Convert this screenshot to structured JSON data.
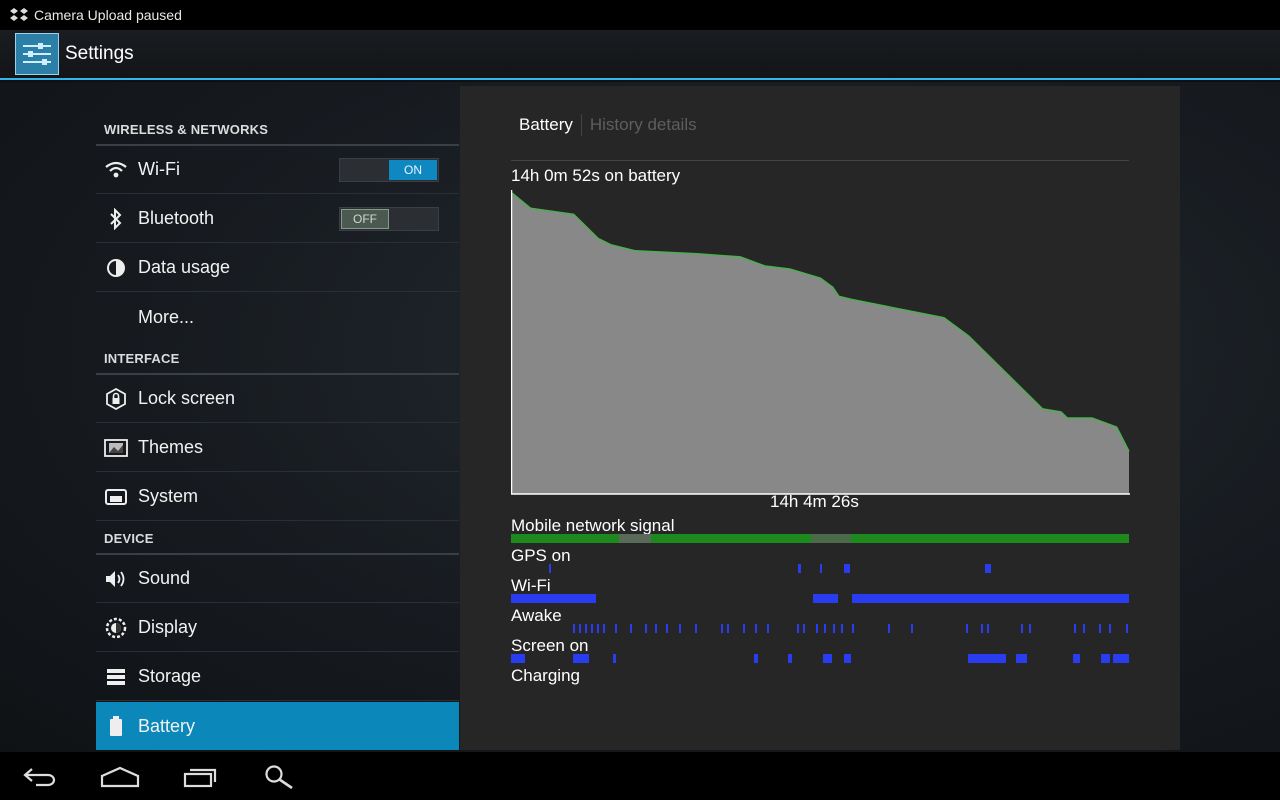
{
  "status_bar": {
    "notification_text": "Camera Upload paused",
    "icon": "dropbox-icon"
  },
  "action_bar": {
    "title": "Settings",
    "icon": "settings-sliders-icon"
  },
  "sidebar": {
    "sections": [
      {
        "header": "WIRELESS & NETWORKS",
        "items": [
          {
            "label": "Wi-Fi",
            "icon": "wifi-icon",
            "toggle": "ON"
          },
          {
            "label": "Bluetooth",
            "icon": "bluetooth-icon",
            "toggle": "OFF"
          },
          {
            "label": "Data usage",
            "icon": "data-usage-icon"
          },
          {
            "label": "More...",
            "icon": ""
          }
        ]
      },
      {
        "header": "INTERFACE",
        "items": [
          {
            "label": "Lock screen",
            "icon": "lock-icon"
          },
          {
            "label": "Themes",
            "icon": "themes-icon"
          },
          {
            "label": "System",
            "icon": "system-icon"
          }
        ]
      },
      {
        "header": "DEVICE",
        "items": [
          {
            "label": "Sound",
            "icon": "speaker-icon"
          },
          {
            "label": "Display",
            "icon": "brightness-icon"
          },
          {
            "label": "Storage",
            "icon": "storage-icon"
          },
          {
            "label": "Battery",
            "icon": "battery-icon",
            "selected": true
          }
        ]
      }
    ]
  },
  "panel": {
    "tabs": {
      "active": "Battery",
      "inactive": "History details"
    },
    "on_battery_text": "14h 0m 52s on battery",
    "duration_text": "14h 4m 26s",
    "tracks": [
      {
        "label": "Mobile network signal"
      },
      {
        "label": "GPS on"
      },
      {
        "label": "Wi-Fi"
      },
      {
        "label": "Awake"
      },
      {
        "label": "Screen on"
      },
      {
        "label": "Charging"
      }
    ]
  },
  "chart_data": {
    "type": "area",
    "title": "14h 0m 52s on battery",
    "xlabel": "14h 4m 26s",
    "ylabel": "",
    "ylim": [
      0,
      100
    ],
    "x_unit": "fraction of elapsed time",
    "x": [
      0,
      0.03,
      0.1,
      0.14,
      0.16,
      0.2,
      0.3,
      0.37,
      0.41,
      0.45,
      0.5,
      0.52,
      0.53,
      0.55,
      0.7,
      0.74,
      0.8,
      0.86,
      0.89,
      0.9,
      0.94,
      0.98,
      1.0
    ],
    "values": [
      99,
      94,
      92,
      84,
      82,
      80,
      79,
      78,
      75,
      74,
      71,
      68,
      65,
      64,
      58,
      52,
      40,
      28,
      27,
      25,
      25,
      22,
      14
    ],
    "colors": {
      "fill": "#888888",
      "stroke": "#4caf50",
      "signal": "#1e8a1e",
      "event": "#2a3cf0"
    }
  }
}
